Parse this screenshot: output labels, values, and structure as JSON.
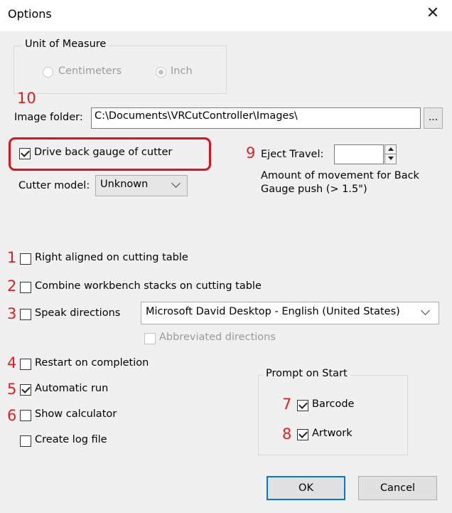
{
  "window": {
    "title": "Options",
    "close_glyph": "✕"
  },
  "unit_of_measure": {
    "legend": "Unit of Measure",
    "options": [
      {
        "label": "Centimeters",
        "selected": false
      },
      {
        "label": "Inch",
        "selected": true
      }
    ]
  },
  "image_folder": {
    "label": "Image folder:",
    "value": "C:\\Documents\\VRCutController\\Images\\",
    "browse_label": "..."
  },
  "drive_back_gauge": {
    "label": "Drive back gauge of cutter",
    "checked": true
  },
  "cutter_model": {
    "label": "Cutter model:",
    "value": "Unknown"
  },
  "eject_travel": {
    "label": "Eject Travel:",
    "value": "",
    "help_line1": "Amount of movement for Back",
    "help_line2": "Gauge push (> 1.5\")"
  },
  "options": [
    {
      "label": "Right aligned on cutting table",
      "checked": false
    },
    {
      "label": "Combine workbench stacks on cutting table",
      "checked": false
    },
    {
      "label": "Speak directions",
      "checked": false
    },
    {
      "label": "Abbreviated directions",
      "checked": false,
      "disabled": true
    },
    {
      "label": "Restart on completion",
      "checked": false
    },
    {
      "label": "Automatic run",
      "checked": true
    },
    {
      "label": "Show calculator",
      "checked": false
    },
    {
      "label": "Create log file",
      "checked": false
    }
  ],
  "voice": {
    "value": "Microsoft David Desktop - English (United States)"
  },
  "prompt_on_start": {
    "legend": "Prompt on Start",
    "items": [
      {
        "label": "Barcode",
        "checked": true
      },
      {
        "label": "Artwork",
        "checked": true
      }
    ]
  },
  "buttons": {
    "ok": "OK",
    "cancel": "Cancel"
  },
  "annotations": [
    "1",
    "2",
    "3",
    "4",
    "5",
    "6",
    "7",
    "8",
    "9",
    "10"
  ],
  "colors": {
    "annotation_red": "#e02020",
    "highlight_red": "#e0101e",
    "default_button_border": "#0078d7"
  }
}
